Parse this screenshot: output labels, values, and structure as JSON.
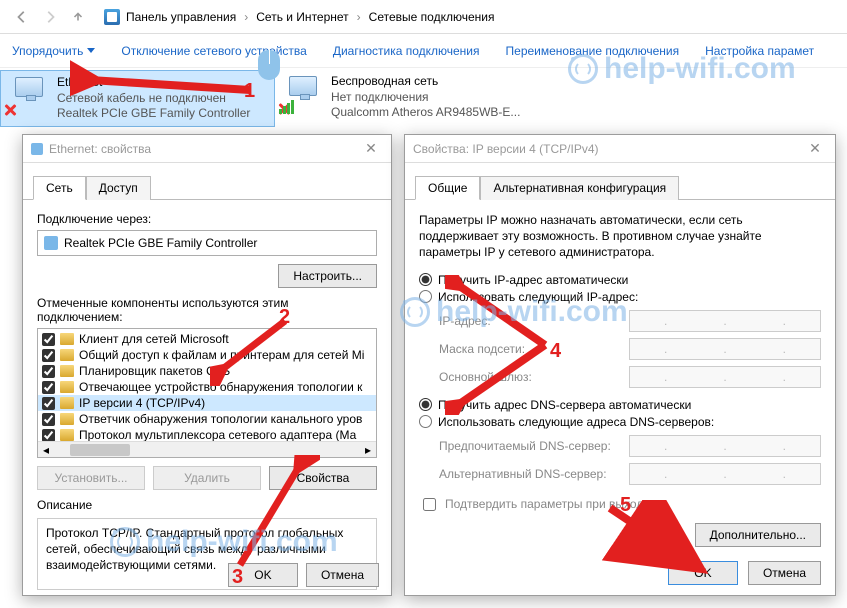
{
  "breadcrumb": {
    "root": "Панель управления",
    "mid": "Сеть и Интернет",
    "leaf": "Сетевые подключения"
  },
  "commands": {
    "organize": "Упорядочить",
    "disable": "Отключение сетевого устройства",
    "diag": "Диагностика подключения",
    "rename": "Переименование подключения",
    "settings": "Настройка парамет"
  },
  "connections": {
    "eth": {
      "title": "Ethernet",
      "line1": "Сетевой кабель не подключен",
      "line2": "Realtek PCIe GBE Family Controller"
    },
    "wifi": {
      "title": "Беспроводная сеть",
      "line1": "Нет подключения",
      "line2": "Qualcomm Atheros AR9485WB-E..."
    }
  },
  "dlg1": {
    "title": "Ethernet: свойства",
    "tab_net": "Сеть",
    "tab_access": "Доступ",
    "connect_via": "Подключение через:",
    "adapter": "Realtek PCIe GBE Family Controller",
    "configure": "Настроить...",
    "components_label": "Отмеченные компоненты используются этим подключением:",
    "items": [
      "Клиент для сетей Microsoft",
      "Общий доступ к файлам и принтерам для сетей Mi",
      "Планировщик пакетов QoS",
      "Отвечающее устройство обнаружения топологии к",
      "IP версии 4 (TCP/IPv4)",
      "Ответчик обнаружения топологии канального уров",
      "Протокол мультиплексора сетевого адаптера (Ма"
    ],
    "install": "Установить...",
    "remove": "Удалить",
    "properties": "Свойства",
    "desc_title": "Описание",
    "desc": "Протокол TCP/IP. Стандартный протокол глобальных сетей, обеспечивающий связь между различными взаимодействующими сетями.",
    "ok": "OK",
    "cancel": "Отмена"
  },
  "dlg2": {
    "title": "Свойства: IP версии 4 (TCP/IPv4)",
    "tab_general": "Общие",
    "tab_alt": "Альтернативная конфигурация",
    "info": "Параметры IP можно назначать автоматически, если сеть поддерживает эту возможность. В противном случае узнайте параметры IP у сетевого администратора.",
    "ip_auto": "Получить IP-адрес автоматически",
    "ip_manual": "Использовать следующий IP-адрес:",
    "ip_addr": "IP-адрес:",
    "mask": "Маска подсети:",
    "gateway": "Основной шлюз:",
    "dns_auto": "Получить адрес DNS-сервера автоматически",
    "dns_manual": "Использовать следующие адреса DNS-серверов:",
    "dns_pref": "Предпочитаемый DNS-сервер:",
    "dns_alt": "Альтернативный DNS-сервер:",
    "confirm": "Подтвердить параметры при выходе",
    "advanced": "Дополнительно...",
    "ok": "OK",
    "cancel": "Отмена"
  },
  "annotations": {
    "n1": "1",
    "n2": "2",
    "n3": "3",
    "n4": "4",
    "n5": "5"
  },
  "watermark": "help-wifi.com"
}
